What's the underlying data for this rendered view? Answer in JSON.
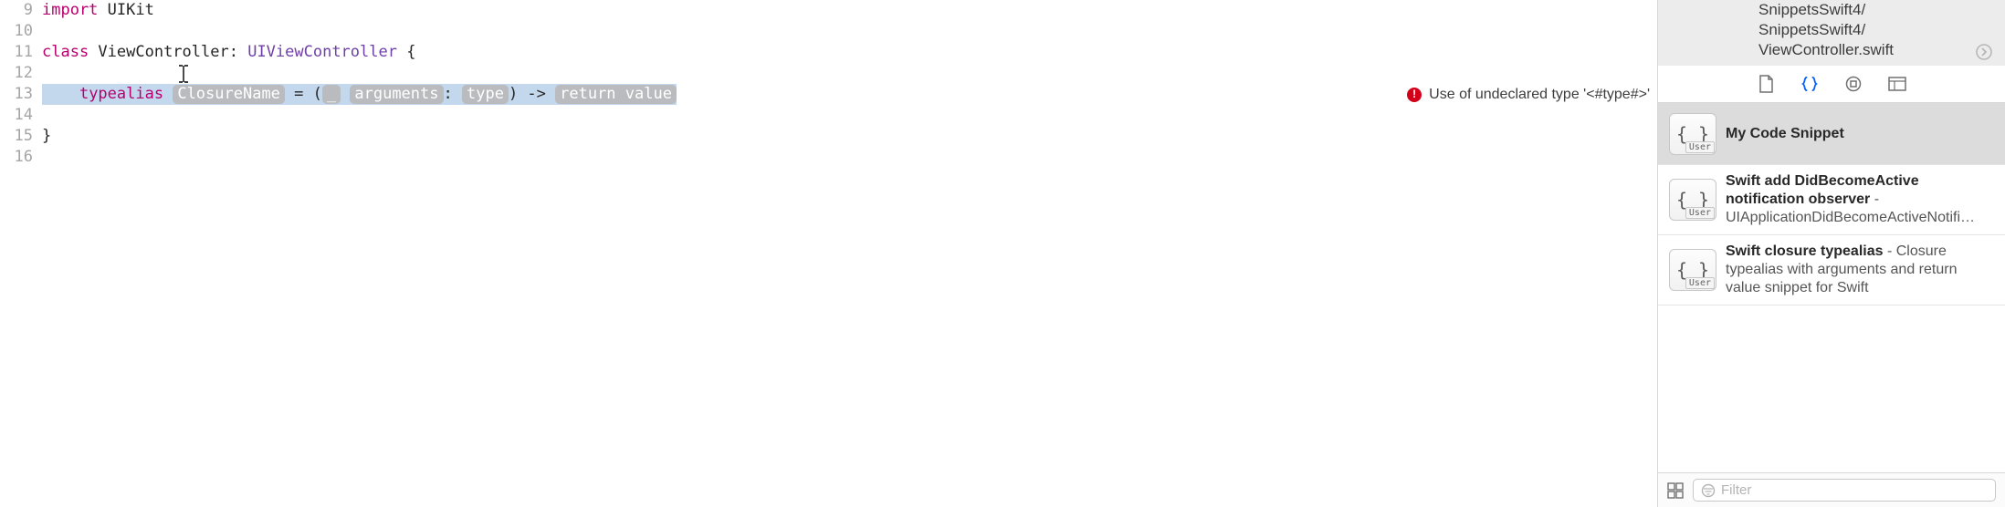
{
  "gutter": {
    "start": 9,
    "end": 16
  },
  "code": {
    "line9": {
      "kw": "import",
      "mod": " UIKit"
    },
    "line11": {
      "kw": "class",
      "name": " ViewController",
      "colon": ": ",
      "super": "UIViewController",
      "brace": " {"
    },
    "line13": {
      "kw": "typealias",
      "space1": " ",
      "ph_name": "ClosureName",
      "eq": " = (",
      "ph_wild": "_",
      "sp2": " ",
      "ph_args": "arguments",
      "colon": ": ",
      "ph_type": "type",
      "close": ") -> ",
      "ph_return": "return value"
    },
    "line15": {
      "brace": "}"
    }
  },
  "error": {
    "message": "Use of undeclared type '<#type#>'"
  },
  "breadcrumb": {
    "line1": "SnippetsSwift4/",
    "line2": "SnippetsSwift4/",
    "line3": "ViewController.swift"
  },
  "snippets": [
    {
      "title": "My Code Snippet",
      "desc": ""
    },
    {
      "title": "Swift add DidBecomeActive notification observer",
      "desc": " - UIApplicationDidBecomeActiveNotifi…"
    },
    {
      "title": "Swift closure typealias",
      "desc": " - Closure typealias with arguments and return value snippet for Swift"
    }
  ],
  "snippet_tag": "User",
  "filter": {
    "placeholder": "Filter"
  }
}
